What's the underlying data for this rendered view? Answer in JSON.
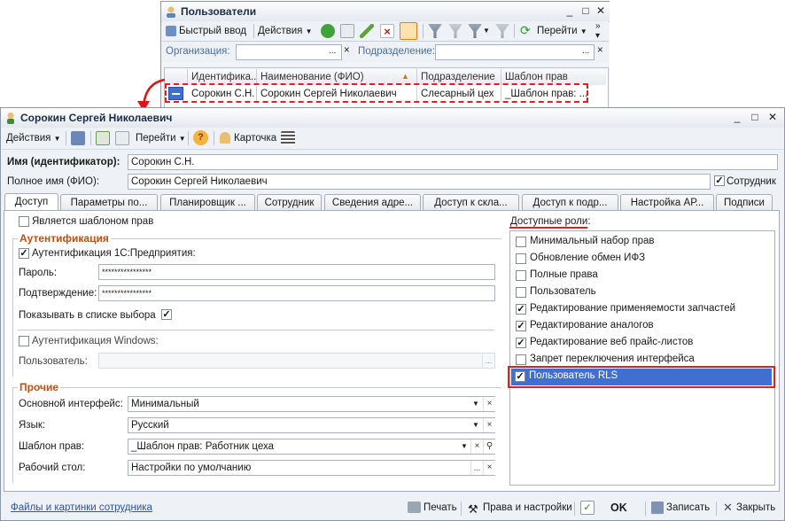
{
  "back_window": {
    "title": "Пользователи",
    "toolbar": {
      "quick_input": "Быстрый ввод",
      "actions": "Действия",
      "goto": "Перейти"
    },
    "filters": {
      "org_label": "Организация:",
      "dept_label": "Подразделение:",
      "ellipsis": "...",
      "clear": "×"
    },
    "columns": [
      "Идентифика...",
      "Наименование (ФИО)",
      "Подразделение",
      "Шаблон прав"
    ],
    "row": [
      "Сорокин С.Н.",
      "Сорокин Сергей Николаевич",
      "Слесарный цех",
      "_Шаблон прав: ..."
    ]
  },
  "main_window": {
    "title": "Сорокин Сергей Николаевич",
    "toolbar": {
      "actions": "Действия",
      "goto": "Перейти",
      "help": "?",
      "card": "Карточка"
    },
    "name_label": "Имя (идентификатор):",
    "name_value": "Сорокин С.Н.",
    "fullname_label": "Полное имя (ФИО):",
    "fullname_value": "Сорокин Сергей Николаевич",
    "employee_label": "Сотрудник",
    "tabs": [
      "Доступ",
      "Параметры по...",
      "Планировщик ...",
      "Сотрудник",
      "Сведения адре...",
      "Доступ к скла...",
      "Доступ к подр...",
      "Настройка АР...",
      "Подписи"
    ],
    "is_template_label": "Является шаблоном прав",
    "auth": {
      "group_title": "Аутентификация",
      "auth_1c_label": "Аутентификация 1С:Предприятия:",
      "password_label": "Пароль:",
      "password_value": "****************",
      "confirm_label": "Подтверждение:",
      "confirm_value": "****************",
      "show_in_list_label": "Показывать в списке выбора",
      "windows_auth_label": "Аутентификация Windows:",
      "user_label": "Пользователь:",
      "ellipsis": "..."
    },
    "other": {
      "group_title": "Прочие",
      "main_interface_label": "Основной интерфейс:",
      "main_interface_value": "Минимальный",
      "language_label": "Язык:",
      "language_value": "Русский",
      "template_label": "Шаблон прав:",
      "template_value": "_Шаблон прав: Работник цеха",
      "desktop_label": "Рабочий стол:",
      "desktop_value": "Настройки по умолчанию",
      "ellipsis": "...",
      "clear": "×"
    },
    "roles_title": "Доступные роли:",
    "roles": [
      {
        "label": "Минимальный набор прав",
        "checked": false
      },
      {
        "label": "Обновление обмен ИФЗ",
        "checked": false
      },
      {
        "label": "Полные права",
        "checked": false
      },
      {
        "label": "Пользователь",
        "checked": false
      },
      {
        "label": "Редактирование применяемости запчастей",
        "checked": true
      },
      {
        "label": "Редактирование аналогов",
        "checked": true
      },
      {
        "label": "Редактирование веб прайс-листов",
        "checked": true
      },
      {
        "label": "Запрет переключения интерфейса",
        "checked": false
      },
      {
        "label": "Пользователь RLS",
        "checked": true
      }
    ],
    "footer": {
      "files_link": "Файлы и картинки сотрудника",
      "print": "Печать",
      "rights": "Права и настройки",
      "ok": "OK",
      "save": "Записать",
      "close": "Закрыть"
    }
  },
  "colors": {
    "accent_red": "#e02020",
    "selection_blue": "#3f6fd1",
    "group_title": "#c05010"
  }
}
